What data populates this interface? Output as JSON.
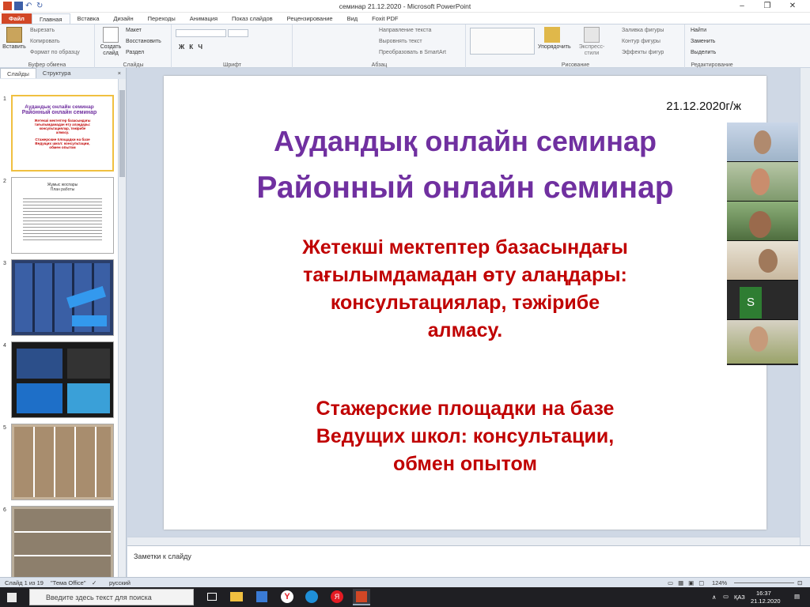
{
  "window": {
    "title": "семинар 21.12.2020 - Microsoft PowerPoint"
  },
  "ribbon_tabs": [
    "Файл",
    "Главная",
    "Вставка",
    "Дизайн",
    "Переходы",
    "Анимация",
    "Показ слайдов",
    "Рецензирование",
    "Вид",
    "Foxit PDF"
  ],
  "clipboard": {
    "paste": "Вставить",
    "cut": "Вырезать",
    "copy": "Копировать",
    "format": "Формат по образцу",
    "label": "Буфер обмена"
  },
  "slides_group": {
    "new": "Создать слайд",
    "layout": "Макет",
    "reset": "Восстановить",
    "section": "Раздел",
    "label": "Слайды"
  },
  "font_group": {
    "label": "Шрифт"
  },
  "paragraph_group": {
    "dir": "Направление текста",
    "align": "Выровнять текст",
    "smartart": "Преобразовать в SmartArt",
    "label": "Абзац"
  },
  "drawing_group": {
    "arrange": "Упорядочить",
    "styles": "Экспресс-стили",
    "fill": "Заливка фигуры",
    "outline": "Контур фигуры",
    "effects": "Эффекты фигур",
    "label": "Рисование"
  },
  "editing_group": {
    "find": "Найти",
    "replace": "Заменить",
    "select": "Выделить",
    "label": "Редактирование"
  },
  "panel": {
    "tab_slides": "Слайды",
    "tab_outline": "Структура",
    "close": "×"
  },
  "thumbs": {
    "n": [
      "1",
      "2",
      "3",
      "4",
      "5",
      "6"
    ],
    "s1": {
      "kz": "Аудандық онлайн семинар",
      "ru": "Районный онлайн семинар",
      "red1": "Жетекші мектептер базасындағы тағылымдамадан өту алаңдары: консультациялар, тәжірибе алмасу.",
      "red2": "Стажерские площадки на базе Ведущих школ: консультации, обмен опытом"
    },
    "s2": {
      "t1": "Жұмыс жоспары",
      "t2": "План работы"
    }
  },
  "slide": {
    "date": "21.12.2020г/ж",
    "title_kz": "Аудандық онлайн семинар",
    "title_ru": "Районный онлайн семинар",
    "red_kz": [
      "Жетекші мектептер базасындағы",
      "тағылымдамадан өту алаңдары:",
      "консультациялар, тәжірибе",
      "алмасу."
    ],
    "red_ru": [
      "Стажерские площадки на базе",
      "Ведущих школ: консультации,",
      "обмен опытом"
    ]
  },
  "video": {
    "initial": "S"
  },
  "notes": {
    "placeholder": "Заметки к слайду"
  },
  "status": {
    "slide": "Слайд 1 из 19",
    "theme": "\"Тема Office\"",
    "lang": "русский",
    "zoom": "124%"
  },
  "taskbar": {
    "search": "Введите здесь текст для поиска",
    "lang": "ҚАЗ",
    "time": "16:37",
    "date": "21.12.2020"
  }
}
